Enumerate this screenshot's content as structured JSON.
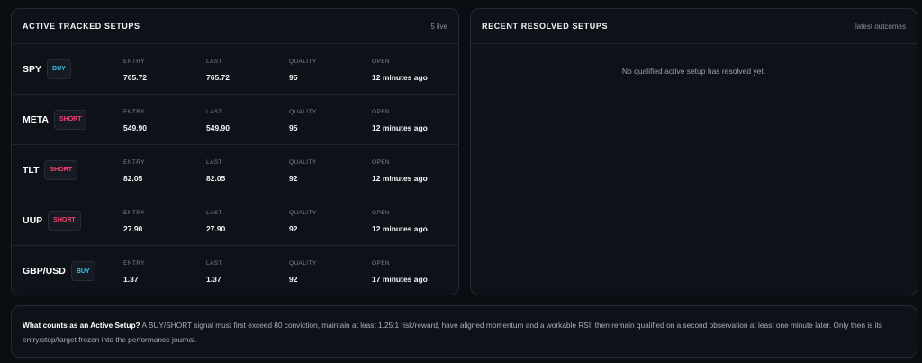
{
  "active": {
    "title": "ACTIVE TRACKED SETUPS",
    "count_label": "5 live",
    "columns": {
      "entry": "ENTRY",
      "last": "LAST",
      "quality": "QUALITY",
      "open": "OPEN"
    },
    "rows": [
      {
        "symbol": "SPY",
        "side": "BUY",
        "entry": "765.72",
        "last": "765.72",
        "quality": "95",
        "open": "12 minutes ago"
      },
      {
        "symbol": "META",
        "side": "SHORT",
        "entry": "549.90",
        "last": "549.90",
        "quality": "95",
        "open": "12 minutes ago"
      },
      {
        "symbol": "TLT",
        "side": "SHORT",
        "entry": "82.05",
        "last": "82.05",
        "quality": "92",
        "open": "12 minutes ago"
      },
      {
        "symbol": "UUP",
        "side": "SHORT",
        "entry": "27.90",
        "last": "27.90",
        "quality": "92",
        "open": "12 minutes ago"
      },
      {
        "symbol": "GBP/USD",
        "side": "BUY",
        "entry": "1.37",
        "last": "1.37",
        "quality": "92",
        "open": "17 minutes ago"
      }
    ]
  },
  "resolved": {
    "title": "RECENT RESOLVED SETUPS",
    "subtitle": "latest outcomes",
    "empty_message": "No qualified active setup has resolved yet."
  },
  "info": {
    "heading": "What counts as an Active Setup?",
    "body": " A BUY/SHORT signal must first exceed 80 conviction, maintain at least 1.25:1 risk/reward, have aligned momentum and a workable RSI, then remain qualified on a second observation at least one minute later. Only then is its entry/stop/target frozen into the performance journal."
  },
  "colors": {
    "buy": "#3ec6ea",
    "short": "#ff3f70",
    "background": "#0a0d12",
    "panel": "#0e1218"
  }
}
